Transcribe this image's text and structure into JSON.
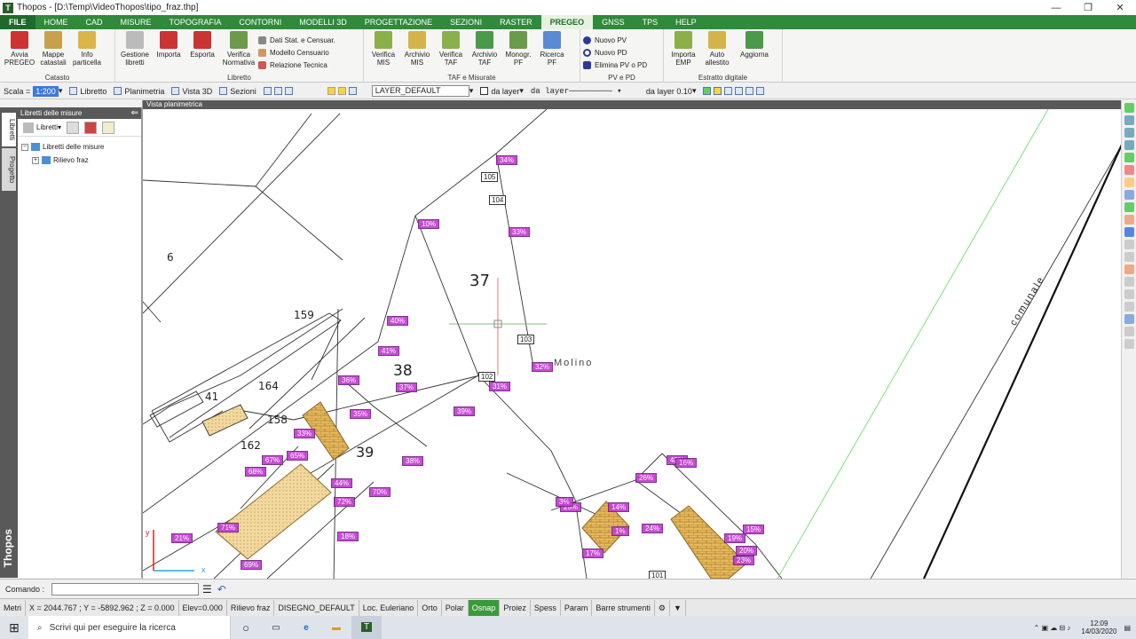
{
  "window": {
    "title": "Thopos - [D:\\Temp\\VideoThopos\\tipo_fraz.thp]",
    "app_letter": "T"
  },
  "menu": [
    "FILE",
    "HOME",
    "CAD",
    "MISURE",
    "TOPOGRAFIA",
    "CONTORNI",
    "MODELLI 3D",
    "PROGETTAZIONE",
    "SEZIONI",
    "RASTER",
    "PREGEO",
    "GNSS",
    "TPS",
    "HELP"
  ],
  "ribbon": {
    "catasto": {
      "label": "Catasto",
      "buttons": [
        "Avvia PREGEO",
        "Mappe catastali",
        "Info particella"
      ]
    },
    "libretto": {
      "label": "Libretto",
      "buttons": [
        "Gestione libretti",
        "Importa",
        "Esporta",
        "Verifica Normativa"
      ],
      "small": [
        "Dati Stat. e Censuar.",
        "Modello Censuario",
        "Relazione Tecnica"
      ]
    },
    "taf": {
      "label": "TAF e Misurate",
      "buttons": [
        "Verifica MIS",
        "Archivio MIS",
        "Verifica TAF",
        "Archivio TAF",
        "Monogr. PF",
        "Ricerca PF"
      ]
    },
    "pv": {
      "label": "PV e PD",
      "small": [
        "Nuovo PV",
        "Nuovo PD",
        "Elimina PV o PD"
      ]
    },
    "estratto": {
      "label": "Estratto digitale",
      "buttons": [
        "Importa EMP",
        "Auto allestito",
        "Aggiorna"
      ]
    }
  },
  "toolbar": {
    "scala_label": "Scala =",
    "scala_value": "1:200",
    "libretto": "Libretto",
    "planimetria": "Planimetria",
    "vista3d": "Vista 3D",
    "sezioni": "Sezioni",
    "layer": "LAYER_DEFAULT",
    "da_layer": "da layer",
    "linetype": "da layer",
    "width": "da layer 0.10"
  },
  "panel": {
    "title": "Libretti delle misure",
    "tab1": "Libretti",
    "tab2": "Progetto",
    "brand": "Thopos",
    "tool_label": "Libretti",
    "tree": [
      "Libretti delle misure",
      "Rilievo fraz"
    ]
  },
  "viewport": {
    "title": "Vista planimetrica",
    "parcels": [
      "6",
      "37",
      "38",
      "41",
      "164",
      "159",
      "158",
      "162",
      "39"
    ],
    "road_label": "comunale",
    "place_label": "Molino",
    "points": [
      "105",
      "104",
      "103",
      "102",
      "101"
    ],
    "tags": [
      "34%",
      "10%",
      "33%",
      "40%",
      "41%",
      "32%",
      "31%",
      "39%",
      "38%",
      "37%",
      "33%",
      "36%",
      "35%",
      "68%",
      "67%",
      "65%",
      "72%",
      "70%",
      "71%",
      "69%",
      "44%",
      "43%",
      "26%",
      "14%",
      "1%",
      "17%",
      "16%",
      "15%",
      "19%",
      "20%",
      "23%",
      "24%",
      "25%",
      "21%",
      "18%",
      "3%"
    ],
    "axes": [
      "y",
      "x"
    ]
  },
  "command": {
    "label": "Comando :"
  },
  "status": [
    "Metri",
    "X = 2044.767 ; Y = -5892.962 ; Z = 0.000",
    "Elev=0.000",
    "Rilievo fraz",
    "DISEGNO_DEFAULT",
    "Loc. Euleriano",
    "Orto",
    "Polar",
    "Osnap",
    "Proiez",
    "Spess",
    "Param",
    "Barre strumenti"
  ],
  "taskbar": {
    "search": "Scrivi qui per eseguire la ricerca",
    "time": "12:09",
    "date": "14/03/2020"
  },
  "colors": {
    "menu_green": "#2f8a3a",
    "tag_purple": "#c43cd4",
    "parcel_hatch": "#e8b75a"
  }
}
